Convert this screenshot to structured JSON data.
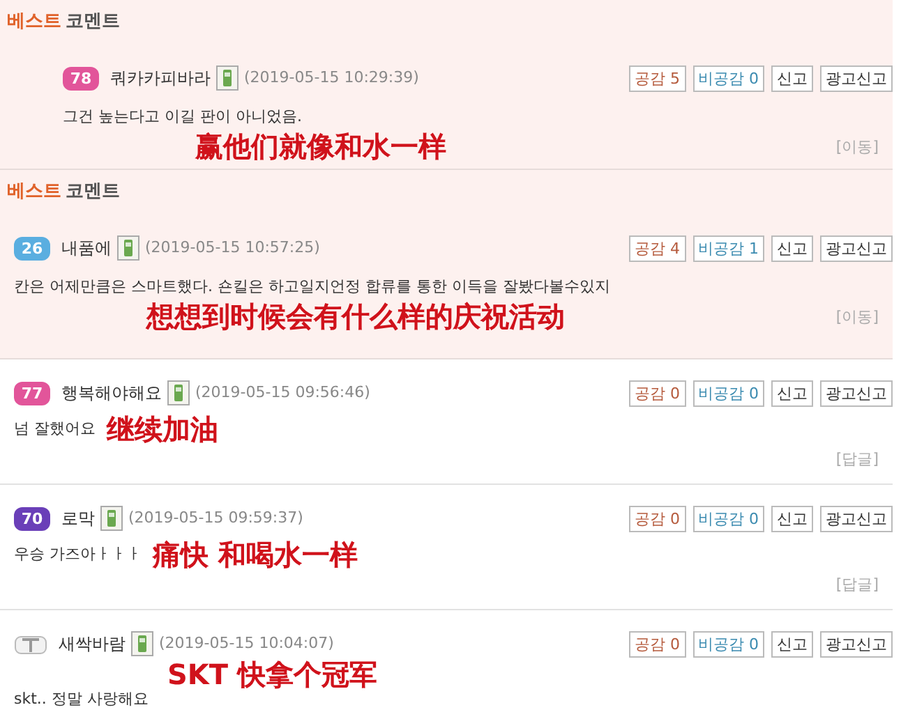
{
  "best_sections": [
    {
      "heading_accent": "베스트",
      "heading_rest": "코멘트",
      "comment": {
        "kind": "level",
        "badge": "78",
        "color": "#e2559a",
        "user": "쿼카카피바라",
        "time": "(2019-05-15 10:29:39)",
        "agree": "공감 5",
        "disagree": "비공감 0",
        "report": "신고",
        "ad_report": "광고신고",
        "text": "그건 높는다고 이길 판이 아니었음.",
        "caption": "赢他们就像和水一样",
        "footer_link": "[이동]"
      }
    },
    {
      "heading_accent": "베스트",
      "heading_rest": "코멘트",
      "comment": {
        "kind": "level",
        "badge": "26",
        "color": "#5aaee0",
        "user": "내품에",
        "time": "(2019-05-15 10:57:25)",
        "agree": "공감 4",
        "disagree": "비공감 1",
        "report": "신고",
        "ad_report": "광고신고",
        "text": "칸은 어제만큼은 스마트했다. 숀킬은 하고일지언정 합류를 통한 이득을 잘봤다볼수있지",
        "caption": "想想到时候会有什么样的庆祝活动",
        "footer_link": "[이동]"
      }
    }
  ],
  "comments": [
    {
      "kind": "level",
      "badge": "77",
      "color": "#e2559a",
      "user": "행복해야해요",
      "time": "(2019-05-15 09:56:46)",
      "agree": "공감 0",
      "disagree": "비공감 0",
      "report": "신고",
      "ad_report": "광고신고",
      "text": "넘 잘했어요",
      "caption": "继续加油",
      "footer_link": "[답글]"
    },
    {
      "kind": "level",
      "badge": "70",
      "color": "#6a3fb8",
      "user": "로막",
      "time": "(2019-05-15 09:59:37)",
      "agree": "공감 0",
      "disagree": "비공감 0",
      "report": "신고",
      "ad_report": "광고신고",
      "text": "우승 가즈아ㅏㅏㅏ",
      "caption": "痛快 和喝水一样",
      "footer_link": "[답글]"
    },
    {
      "kind": "sprout",
      "user": "새싹바람",
      "time": "(2019-05-15 10:04:07)",
      "agree": "공감 0",
      "disagree": "비공감 0",
      "report": "신고",
      "ad_report": "광고신고",
      "text": "skt.. 정말 사랑해요",
      "caption": "SKT 快拿个冠军"
    }
  ]
}
